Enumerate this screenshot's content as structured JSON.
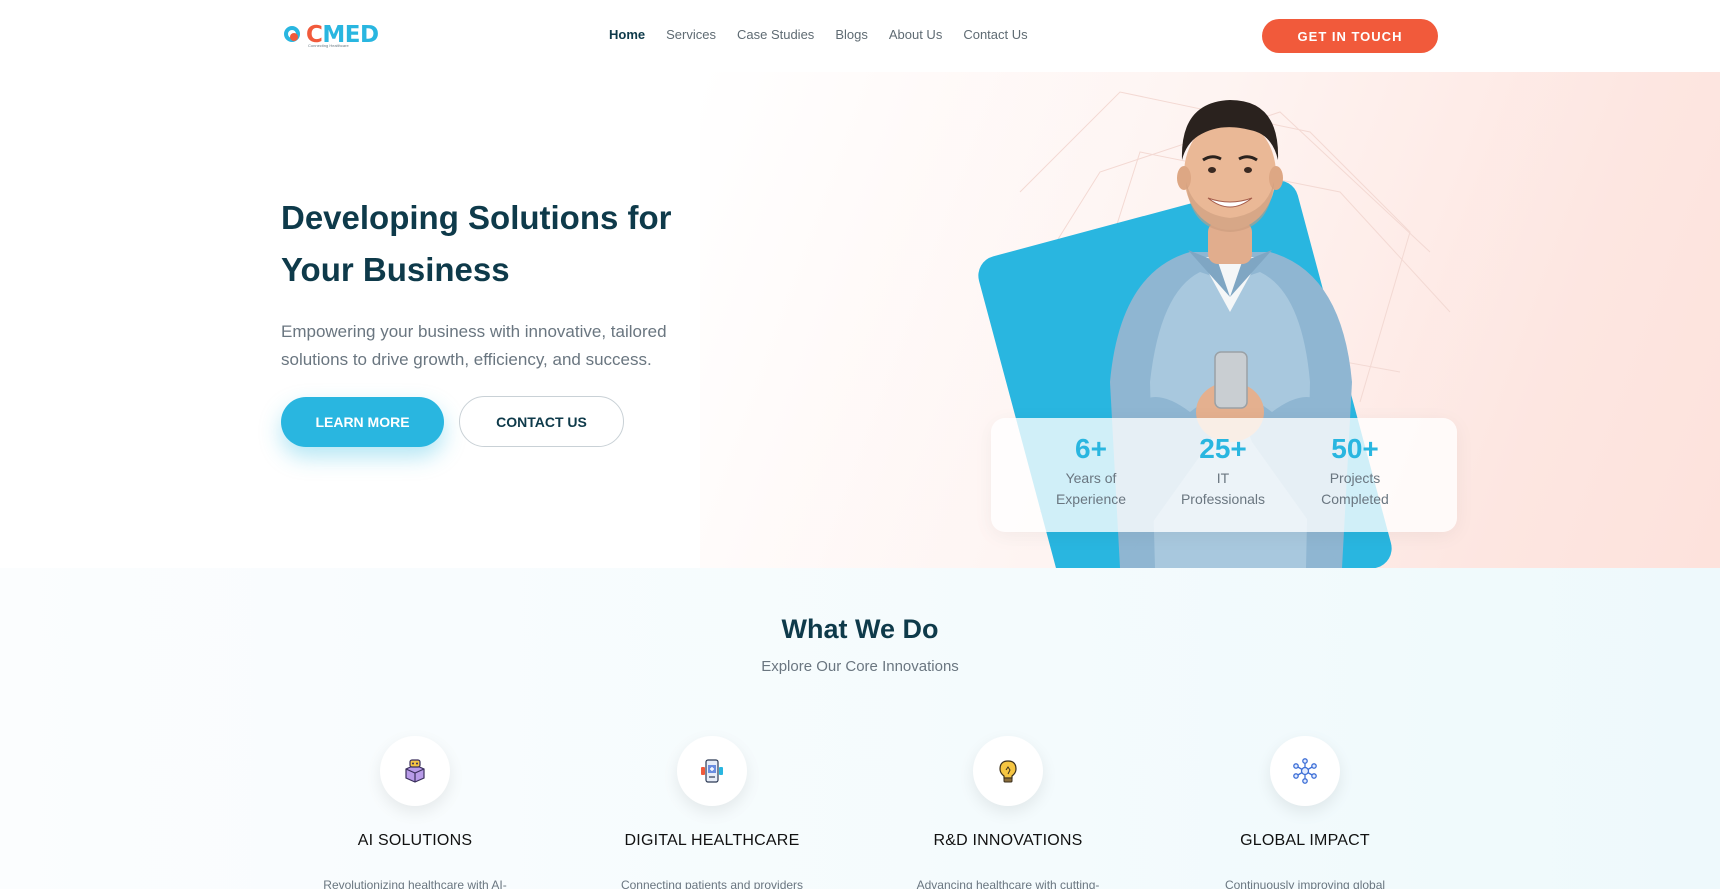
{
  "nav": {
    "logo_text_c": "C",
    "logo_text_med": "MED",
    "logo_tagline": "Connecting Healthcare",
    "items": [
      {
        "label": "Home",
        "active": true
      },
      {
        "label": "Services",
        "active": false
      },
      {
        "label": "Case Studies",
        "active": false
      },
      {
        "label": "Blogs",
        "active": false
      },
      {
        "label": "About Us",
        "active": false
      },
      {
        "label": "Contact Us",
        "active": false
      }
    ],
    "cta_label": "GET IN TOUCH"
  },
  "hero": {
    "title_line1": "Developing Solutions for",
    "title_line2": "Your Business",
    "subtitle": "Empowering your business with innovative, tailored solutions to drive growth, efficiency, and success.",
    "learn_more_label": "LEARN MORE",
    "contact_label": "CONTACT US",
    "stats": [
      {
        "value": "6+",
        "label_line1": "Years of",
        "label_line2": "Experience"
      },
      {
        "value": "25+",
        "label_line1": "IT",
        "label_line2": "Professionals"
      },
      {
        "value": "50+",
        "label_line1": "Projects",
        "label_line2": "Completed"
      }
    ]
  },
  "what_we_do": {
    "title": "What We Do",
    "subtitle": "Explore Our Core Innovations",
    "features": [
      {
        "name": "AI SOLUTIONS",
        "icon": "ai-box-icon",
        "desc": "Revolutionizing healthcare with AI-"
      },
      {
        "name": "DIGITAL HEALTHCARE",
        "icon": "digital-health-icon",
        "desc": "Connecting patients and providers"
      },
      {
        "name": "R&D INNOVATIONS",
        "icon": "lightbulb-icon",
        "desc": "Advancing healthcare with cutting-"
      },
      {
        "name": "GLOBAL IMPACT",
        "icon": "network-icon",
        "desc": "Continuously improving global"
      }
    ]
  },
  "colors": {
    "primary_blue": "#29b6e0",
    "accent_orange": "#f15a3b",
    "heading": "#0e3a4a"
  }
}
